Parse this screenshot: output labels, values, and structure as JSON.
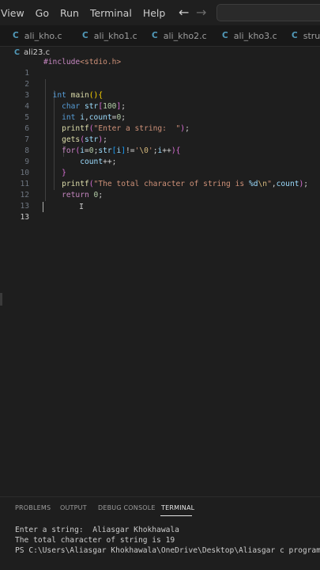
{
  "menubar": {
    "items": [
      "View",
      "Go",
      "Run",
      "Terminal",
      "Help"
    ],
    "back_arrow": "←",
    "forward_arrow": "→"
  },
  "tabs": [
    {
      "badge": "C",
      "label": "ali_kho.c"
    },
    {
      "badge": "C",
      "label": "ali_kho1.c"
    },
    {
      "badge": "C",
      "label": "ali_kho2.c"
    },
    {
      "badge": "C",
      "label": "ali_kho3.c"
    },
    {
      "badge": "C",
      "label": "struct"
    }
  ],
  "breadcrumb": {
    "badge": "C",
    "file": "ali23.c"
  },
  "editor": {
    "line_numbers": [
      "1",
      "2",
      "3",
      "4",
      "5",
      "6",
      "7",
      "8",
      "9",
      "10",
      "11",
      "12",
      "13"
    ],
    "active_line": "13"
  },
  "panel": {
    "tabs": [
      "PROBLEMS",
      "OUTPUT",
      "DEBUG CONSOLE",
      "TERMINAL"
    ],
    "active_tab": "TERMINAL"
  },
  "terminal": {
    "lines": [
      "Enter a string:  Aliasgar Khokhawala",
      "The total character of string is 19",
      "PS C:\\Users\\Aliasgar Khokhawala\\OneDrive\\Desktop\\Aliasgar c program>"
    ]
  },
  "colors": {
    "background": "#1e1e1e",
    "keyword": "#569cd6",
    "control_keyword": "#c586c0",
    "function": "#dcdcaa",
    "string": "#ce9178",
    "number": "#b5cea8",
    "c_badge": "#519aba"
  }
}
